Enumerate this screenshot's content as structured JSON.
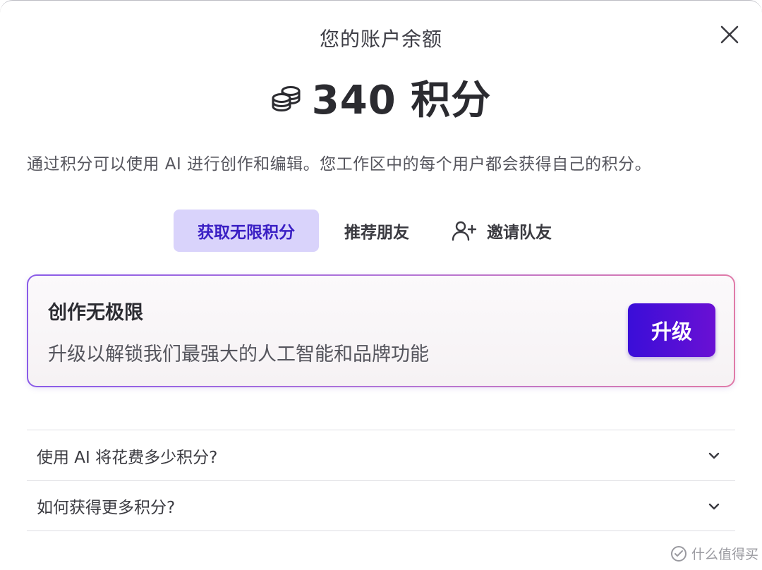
{
  "modal": {
    "title": "您的账户余额",
    "balance": "340 积分",
    "description": "通过积分可以使用 AI 进行创作和编辑。您工作区中的每个用户都会获得自己的积分。"
  },
  "tabs": [
    {
      "label": "获取无限积分",
      "active": true
    },
    {
      "label": "推荐朋友",
      "active": false
    },
    {
      "label": "邀请队友",
      "active": false
    }
  ],
  "promo": {
    "title": "创作无极限",
    "subtitle": "升级以解锁我们最强大的人工智能和品牌功能",
    "button_label": "升级"
  },
  "faq": [
    {
      "question": "使用 AI 将花费多少积分?"
    },
    {
      "question": "如何获得更多积分?"
    }
  ],
  "watermark": {
    "text": "什么值得买"
  },
  "colors": {
    "accent": "#3a1fc4",
    "active_tab_bg": "#d9d3fb",
    "button_gradient_start": "#3a0ed8",
    "button_gradient_end": "#6a10d4"
  },
  "icons": {
    "close": "close-icon",
    "coins": "coins-icon",
    "invite": "add-user-icon",
    "chevron": "chevron-down-icon"
  }
}
